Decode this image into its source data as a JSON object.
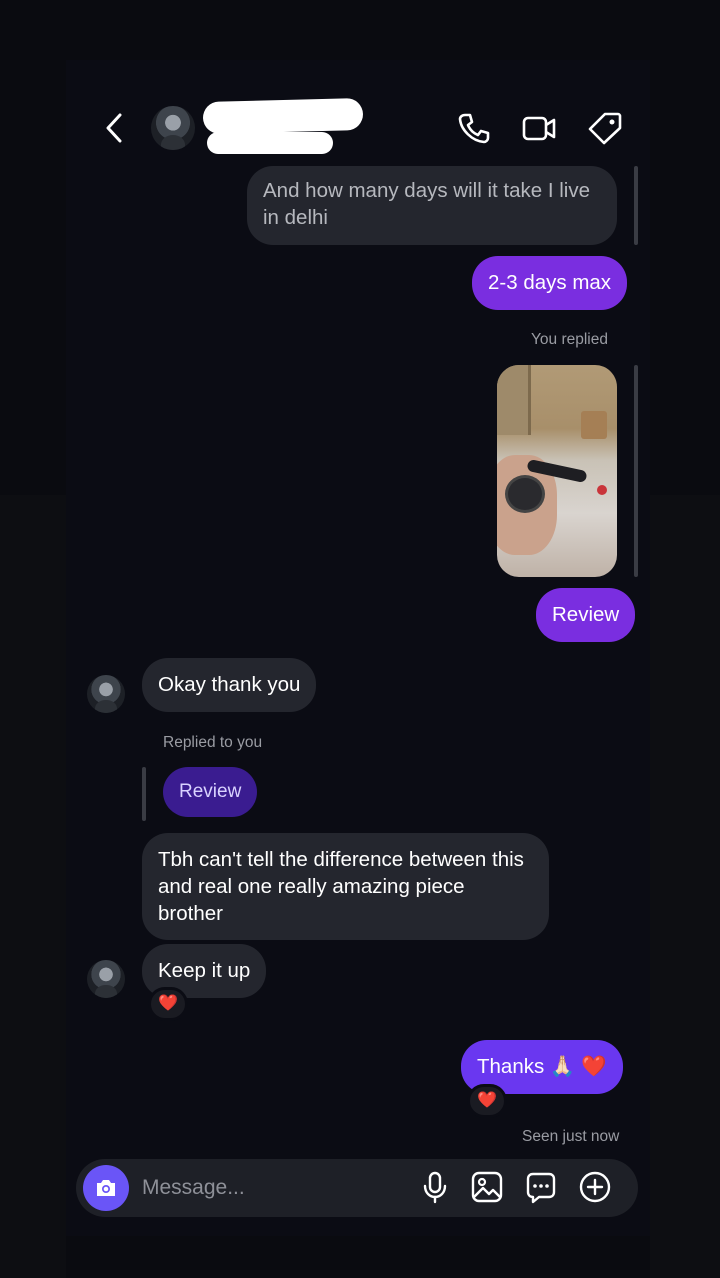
{
  "header": {
    "back": "back",
    "icons": [
      "phone-icon",
      "video-icon",
      "tag-icon"
    ]
  },
  "messages": {
    "m1": "And how many days will it take I live in delhi",
    "m2": "2-3 days max",
    "you_replied": "You replied",
    "m3": "Review",
    "m4": "Okay thank you",
    "replied_to_you": "Replied to you",
    "quote": "Review",
    "m5": "Tbh can't tell the difference between this and real one really amazing piece brother",
    "m6": "Keep it up",
    "m6_reaction": "❤️",
    "m7": "Thanks 🙏🏻 ❤️",
    "m7_reaction": "❤️",
    "seen": "Seen just now"
  },
  "composer": {
    "placeholder": "Message..."
  },
  "colors": {
    "outgoing": "#7a2ee0",
    "outgoing_last": "#6a37f0",
    "incoming": "#24262e",
    "accent": "#6a55f7"
  }
}
